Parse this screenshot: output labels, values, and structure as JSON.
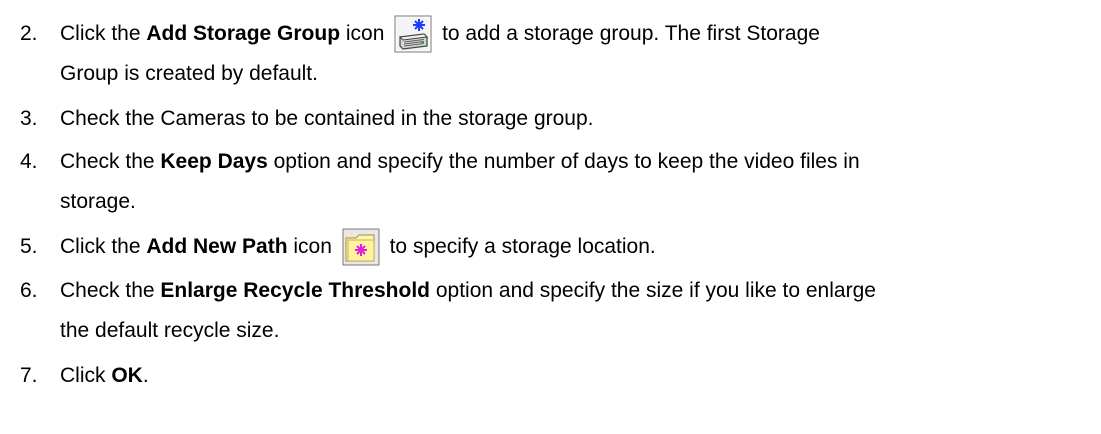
{
  "steps": [
    {
      "number": "2.",
      "pre": "Click the ",
      "bold": "Add Storage Group",
      "mid": " icon",
      "icon": "add-storage-group-icon",
      "post": " to add a storage group. The first Storage",
      "line2": "Group is created by default."
    },
    {
      "number": "3.",
      "text": "Check the Cameras to be contained in the storage group."
    },
    {
      "number": "4.",
      "pre": "Check the ",
      "bold": "Keep Days",
      "post": " option and specify the number of days to keep the video files in",
      "line2": "storage."
    },
    {
      "number": "5.",
      "pre": "Click the ",
      "bold": "Add New Path",
      "mid": " icon",
      "icon": "add-new-path-icon",
      "post": " to specify a storage location."
    },
    {
      "number": "6.",
      "pre": "Check the ",
      "bold": "Enlarge Recycle Threshold",
      "post": " option and specify the size if you like to enlarge",
      "line2": "the default recycle size."
    },
    {
      "number": "7.",
      "pre": "Click ",
      "bold": "OK",
      "post": "."
    }
  ],
  "colors": {
    "text": "#000000",
    "storage_icon_star": "#1a3cff",
    "path_icon_folder": "#fff3a8",
    "path_icon_star": "#e020e0"
  }
}
